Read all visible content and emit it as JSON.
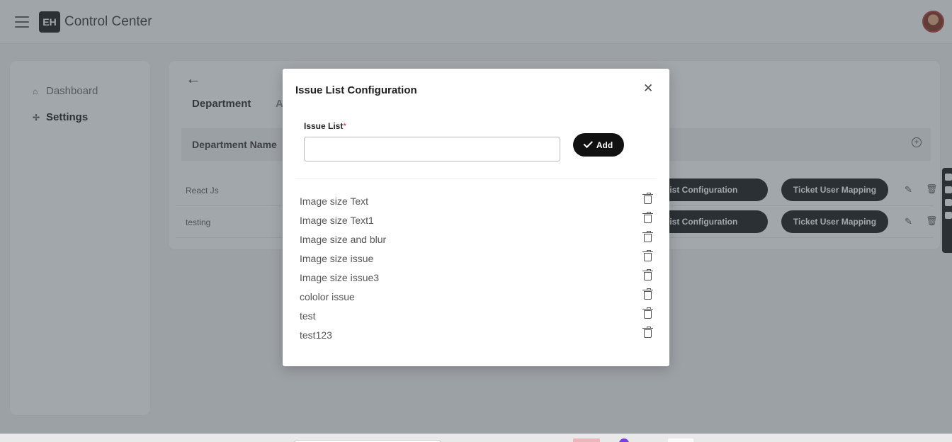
{
  "header": {
    "app_title": "Control Center",
    "logo_text": "EH"
  },
  "sidebar": {
    "items": [
      {
        "label": "Dashboard",
        "icon": "home-icon"
      },
      {
        "label": "Settings",
        "icon": "slack-icon"
      }
    ]
  },
  "main": {
    "tabs": [
      {
        "label": "Department"
      },
      {
        "label": "A"
      }
    ],
    "table": {
      "headers": [
        "Department Name"
      ],
      "rows": [
        {
          "name": "React Js",
          "issue_button": "ue List Configuration",
          "ticket_button": "Ticket User Mapping"
        },
        {
          "name": "testing",
          "issue_button": "ue List Configuration",
          "ticket_button": "Ticket User Mapping"
        }
      ]
    }
  },
  "modal": {
    "title": "Issue List Configuration",
    "field_label": "Issue List",
    "required_mark": "*",
    "input_value": "",
    "add_label": "Add",
    "issues": [
      "Image size Text",
      "Image size Text1",
      "Image size and blur",
      "Image size issue",
      "Image size issue3",
      "cololor issue",
      "test",
      "test123"
    ]
  }
}
